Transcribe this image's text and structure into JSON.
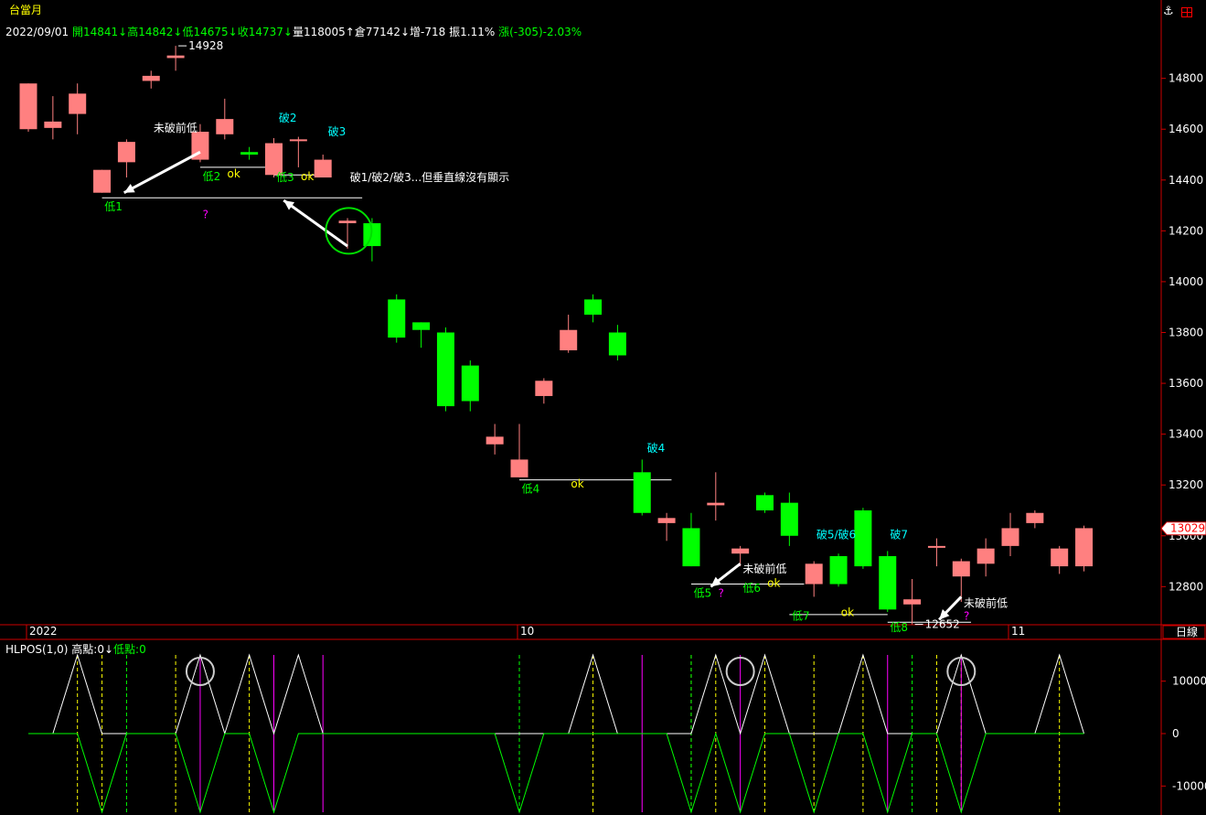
{
  "header": {
    "symbol": "台當月",
    "date": "2022/09/01",
    "open": "開14841↓",
    "high": "高14842↓",
    "low": "低14675↓",
    "close": "收14737↓",
    "volume": "量118005↑",
    "oi": "倉77142↓",
    "oi_change": "增-718",
    "amplitude": "振1.11%",
    "change": "漲(-305)-2.03%",
    "anchor_icon": "anchor-icon",
    "window_icon": "window-icon"
  },
  "indicator_header": {
    "name": "HLPOS(1,0)",
    "high": "高點:0↓",
    "low": "低點:0"
  },
  "colors": {
    "up": "#ff8080",
    "down": "#00ff00",
    "axis": "#cc0000",
    "green_label": "#00ff00",
    "cyan_label": "#00ffff",
    "yellow_label": "#ffff00",
    "magenta": "#ff00ff",
    "white": "#ffffff"
  },
  "chart_data": [
    {
      "type": "candlestick",
      "title": "台當月",
      "period": "日線",
      "ylim": [
        12650,
        14950
      ],
      "y_ticks": [
        12800,
        13000,
        13200,
        13400,
        13600,
        13800,
        14000,
        14200,
        14400,
        14600,
        14800
      ],
      "y_tick_labels": [
        "12800",
        "13000",
        "13200",
        "13400",
        "13600",
        "13800",
        "14000",
        "14200",
        "14400",
        "14600",
        "14800"
      ],
      "x_labels": [
        {
          "label": "2022",
          "index": 0
        },
        {
          "label": "10",
          "index": 20
        },
        {
          "label": "11",
          "index": 40
        }
      ],
      "last_price": "13029",
      "candles": [
        {
          "o": 14600,
          "h": 14780,
          "l": 14590,
          "c": 14780
        },
        {
          "o": 14605,
          "h": 14730,
          "l": 14560,
          "c": 14630
        },
        {
          "o": 14660,
          "h": 14780,
          "l": 14580,
          "c": 14740
        },
        {
          "o": 14350,
          "h": 14440,
          "l": 14350,
          "c": 14440
        },
        {
          "o": 14470,
          "h": 14560,
          "l": 14410,
          "c": 14550
        },
        {
          "o": 14790,
          "h": 14830,
          "l": 14760,
          "c": 14810
        },
        {
          "o": 14880,
          "h": 14928,
          "l": 14830,
          "c": 14890
        },
        {
          "o": 14480,
          "h": 14620,
          "l": 14470,
          "c": 14590
        },
        {
          "o": 14580,
          "h": 14720,
          "l": 14560,
          "c": 14640
        },
        {
          "o": 14510,
          "h": 14530,
          "l": 14480,
          "c": 14500
        },
        {
          "o": 14420,
          "h": 14565,
          "l": 14410,
          "c": 14545
        },
        {
          "o": 14555,
          "h": 14570,
          "l": 14450,
          "c": 14560
        },
        {
          "o": 14410,
          "h": 14500,
          "l": 14410,
          "c": 14480
        },
        {
          "o": 14230,
          "h": 14250,
          "l": 14130,
          "c": 14240
        },
        {
          "o": 14230,
          "h": 14250,
          "l": 14080,
          "c": 14140
        },
        {
          "o": 13930,
          "h": 13950,
          "l": 13760,
          "c": 13780
        },
        {
          "o": 13840,
          "h": 13840,
          "l": 13740,
          "c": 13810
        },
        {
          "o": 13800,
          "h": 13820,
          "l": 13490,
          "c": 13510
        },
        {
          "o": 13670,
          "h": 13690,
          "l": 13490,
          "c": 13530
        },
        {
          "o": 13360,
          "h": 13440,
          "l": 13320,
          "c": 13390
        },
        {
          "o": 13230,
          "h": 13440,
          "l": 13230,
          "c": 13300
        },
        {
          "o": 13550,
          "h": 13620,
          "l": 13520,
          "c": 13610
        },
        {
          "o": 13730,
          "h": 13870,
          "l": 13720,
          "c": 13810
        },
        {
          "o": 13930,
          "h": 13950,
          "l": 13840,
          "c": 13870
        },
        {
          "o": 13800,
          "h": 13830,
          "l": 13690,
          "c": 13710
        },
        {
          "o": 13250,
          "h": 13300,
          "l": 13080,
          "c": 13090
        },
        {
          "o": 13050,
          "h": 13090,
          "l": 12980,
          "c": 13070
        },
        {
          "o": 13030,
          "h": 13090,
          "l": 12880,
          "c": 12880
        },
        {
          "o": 13120,
          "h": 13250,
          "l": 13060,
          "c": 13130
        },
        {
          "o": 12930,
          "h": 12960,
          "l": 12880,
          "c": 12950
        },
        {
          "o": 13160,
          "h": 13170,
          "l": 13090,
          "c": 13100
        },
        {
          "o": 13130,
          "h": 13170,
          "l": 12960,
          "c": 13000
        },
        {
          "o": 12810,
          "h": 12900,
          "l": 12760,
          "c": 12890
        },
        {
          "o": 12920,
          "h": 12930,
          "l": 12800,
          "c": 12810
        },
        {
          "o": 13100,
          "h": 13110,
          "l": 12870,
          "c": 12880
        },
        {
          "o": 12920,
          "h": 12940,
          "l": 12700,
          "c": 12710
        },
        {
          "o": 12730,
          "h": 12830,
          "l": 12652,
          "c": 12750
        },
        {
          "o": 12960,
          "h": 12990,
          "l": 12880,
          "c": 12960
        },
        {
          "o": 12840,
          "h": 12910,
          "l": 12740,
          "c": 12900
        },
        {
          "o": 12890,
          "h": 12990,
          "l": 12840,
          "c": 12950
        },
        {
          "o": 12960,
          "h": 13090,
          "l": 12920,
          "c": 13030
        },
        {
          "o": 13050,
          "h": 13100,
          "l": 13030,
          "c": 13090
        },
        {
          "o": 12880,
          "h": 12960,
          "l": 12850,
          "c": 12950
        },
        {
          "o": 12880,
          "h": 13040,
          "l": 12860,
          "c": 13030
        }
      ],
      "annotations": [
        {
          "text": "14928",
          "index": 6,
          "price": 14928,
          "color": "white",
          "leader": true
        },
        {
          "text": "12652",
          "index": 36,
          "price": 12652,
          "color": "white",
          "leader": true
        },
        {
          "text": "未破前低",
          "index": 5.1,
          "price": 14590,
          "color": "white"
        },
        {
          "text": "未破前低",
          "index": 29.1,
          "price": 12855,
          "color": "white"
        },
        {
          "text": "未破前低",
          "index": 38.1,
          "price": 12720,
          "color": "white"
        },
        {
          "text": "破1/破2/破3...但垂直線沒有顯示",
          "index": 13.1,
          "price": 14395,
          "color": "white"
        },
        {
          "text": "低1",
          "index": 3.1,
          "price": 14280,
          "color": "green_label"
        },
        {
          "text": "低2",
          "index": 7.1,
          "price": 14400,
          "color": "green_label"
        },
        {
          "text": "低3",
          "index": 10.1,
          "price": 14395,
          "color": "green_label"
        },
        {
          "text": "低4",
          "index": 20.1,
          "price": 13170,
          "color": "green_label"
        },
        {
          "text": "低5",
          "index": 27.1,
          "price": 12760,
          "color": "green_label"
        },
        {
          "text": "低6",
          "index": 29.1,
          "price": 12780,
          "color": "green_label"
        },
        {
          "text": "低7",
          "index": 31.1,
          "price": 12670,
          "color": "green_label"
        },
        {
          "text": "低8",
          "index": 35.1,
          "price": 12625,
          "color": "green_label"
        },
        {
          "text": "破2",
          "index": 10.2,
          "price": 14630,
          "color": "cyan_label"
        },
        {
          "text": "破3",
          "index": 12.2,
          "price": 14575,
          "color": "cyan_label"
        },
        {
          "text": "破4",
          "index": 25.2,
          "price": 13330,
          "color": "cyan_label"
        },
        {
          "text": "破5/破6",
          "index": 32.1,
          "price": 12990,
          "color": "cyan_label"
        },
        {
          "text": "破7",
          "index": 35.1,
          "price": 12990,
          "color": "cyan_label"
        },
        {
          "text": "ok",
          "index": 8.1,
          "price": 14410,
          "color": "yellow_label"
        },
        {
          "text": "ok",
          "index": 11.1,
          "price": 14400,
          "color": "yellow_label"
        },
        {
          "text": "ok",
          "index": 22.1,
          "price": 13190,
          "color": "yellow_label"
        },
        {
          "text": "ok",
          "index": 30.1,
          "price": 12800,
          "color": "yellow_label"
        },
        {
          "text": "ok",
          "index": 33.1,
          "price": 12685,
          "color": "yellow_label"
        },
        {
          "text": "?",
          "index": 7.1,
          "price": 14250,
          "color": "magenta"
        },
        {
          "text": "?",
          "index": 28.1,
          "price": 12760,
          "color": "magenta"
        },
        {
          "text": "?",
          "index": 38.1,
          "price": 12670,
          "color": "magenta"
        }
      ],
      "level_lines": [
        {
          "price": 14330,
          "from": 3,
          "to": 13.6
        },
        {
          "price": 14450,
          "from": 7,
          "to": 10
        },
        {
          "price": 14420,
          "from": 10,
          "to": 12
        },
        {
          "price": 13220,
          "from": 20,
          "to": 26.2
        },
        {
          "price": 12810,
          "from": 27,
          "to": 31.6
        },
        {
          "price": 12690,
          "from": 31,
          "to": 35
        },
        {
          "price": 12660,
          "from": 35,
          "to": 38.4
        }
      ],
      "arrows": [
        {
          "from": [
            7,
            14510
          ],
          "to": [
            3.9,
            14350
          ]
        },
        {
          "from": [
            13,
            14140
          ],
          "to": [
            10.4,
            14320
          ]
        },
        {
          "from": [
            29,
            12890
          ],
          "to": [
            27.8,
            12800
          ]
        },
        {
          "from": [
            38,
            12760
          ],
          "to": [
            37.1,
            12670
          ]
        }
      ],
      "circles": [
        {
          "index": 13.05,
          "price": 14200
        }
      ]
    },
    {
      "type": "line",
      "title": "HLPOS(1,0)",
      "ylim": [
        -15000,
        15000
      ],
      "y_ticks": [
        -10000,
        0,
        10000
      ],
      "y_tick_labels": [
        "-10000",
        "0",
        "10000"
      ],
      "series": [
        {
          "name": "高點",
          "color": "white",
          "x": [
            0,
            1,
            2,
            3,
            4,
            5,
            6,
            7,
            8,
            9,
            10,
            11,
            12,
            13,
            14,
            15,
            16,
            17,
            18,
            19,
            20,
            21,
            22,
            23,
            24,
            25,
            26,
            27,
            28,
            29,
            30,
            31,
            32,
            33,
            34,
            35,
            36,
            37,
            38,
            39,
            40,
            41,
            42,
            43
          ],
          "values": [
            0,
            0,
            15000,
            0,
            0,
            0,
            0,
            15000,
            0,
            15000,
            0,
            15000,
            0,
            0,
            0,
            0,
            0,
            0,
            0,
            0,
            0,
            0,
            0,
            15000,
            0,
            0,
            0,
            0,
            15000,
            0,
            15000,
            0,
            0,
            0,
            15000,
            0,
            0,
            0,
            15000,
            0,
            0,
            0,
            15000,
            0
          ]
        },
        {
          "name": "低點",
          "color": "green",
          "x": [
            0,
            1,
            2,
            3,
            4,
            5,
            6,
            7,
            8,
            9,
            10,
            11,
            12,
            13,
            14,
            15,
            16,
            17,
            18,
            19,
            20,
            21,
            22,
            23,
            24,
            25,
            26,
            27,
            28,
            29,
            30,
            31,
            32,
            33,
            34,
            35,
            36,
            37,
            38,
            39,
            40,
            41,
            42,
            43
          ],
          "values": [
            0,
            0,
            0,
            -15000,
            0,
            0,
            0,
            -15000,
            0,
            0,
            -15000,
            0,
            0,
            0,
            0,
            0,
            0,
            0,
            0,
            0,
            -15000,
            0,
            0,
            0,
            0,
            0,
            0,
            -15000,
            0,
            -15000,
            0,
            0,
            -15000,
            0,
            0,
            -15000,
            0,
            0,
            -15000,
            0,
            0,
            0,
            0,
            0
          ]
        }
      ],
      "markers": {
        "yellow_dashed": [
          2,
          3,
          6,
          9,
          20,
          23,
          27,
          28,
          30,
          32,
          34,
          37,
          38,
          42
        ],
        "green_dashed": [
          4,
          20,
          27,
          36
        ],
        "magenta_solid": [
          7,
          10,
          12,
          25,
          29,
          35,
          38
        ]
      },
      "circles": [
        7,
        29,
        38
      ]
    }
  ]
}
